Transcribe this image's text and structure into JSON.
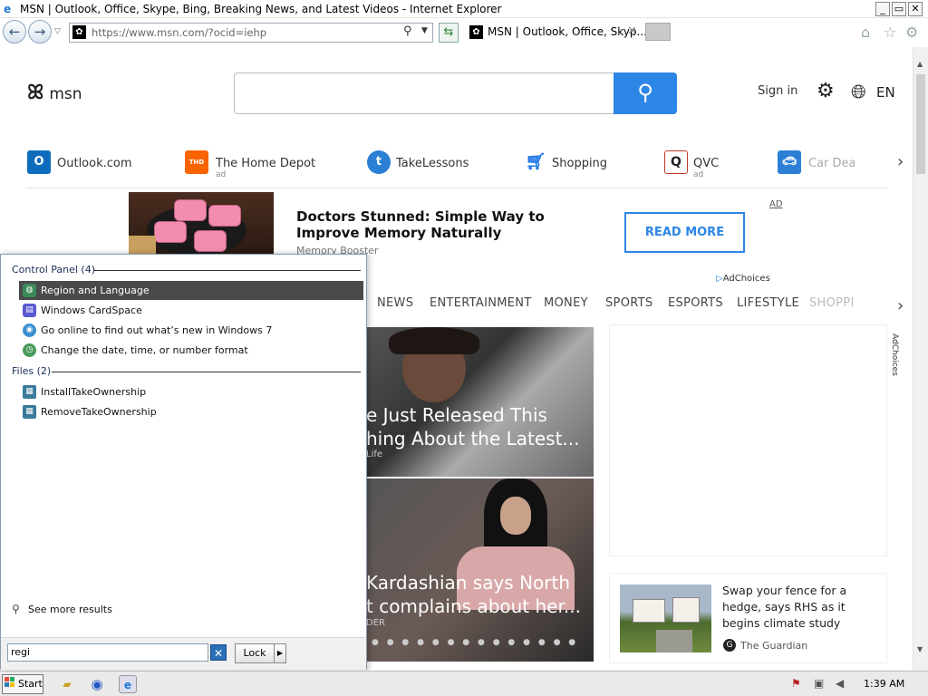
{
  "window": {
    "title": "MSN | Outlook, Office, Skype, Bing, Breaking News, and Latest Videos - Internet Explorer",
    "min": "_",
    "max": "▭",
    "close": "✕"
  },
  "browser": {
    "url": "https://www.msn.com/?ocid=iehp",
    "tab_title": "MSN | Outlook, Office, Skyp...",
    "tab_close": "✕"
  },
  "msn": {
    "logo_text": "msn",
    "search_placeholder": "",
    "sign_in": "Sign in",
    "language": "EN",
    "quicklinks": [
      {
        "label": "Outlook.com",
        "ad": "",
        "icon": "outlook-icon",
        "color": "#0f6cbd"
      },
      {
        "label": "The Home Depot",
        "ad": "ad",
        "icon": "home-depot-icon",
        "color": "#f96302"
      },
      {
        "label": "TakeLessons",
        "ad": "",
        "icon": "takelessons-icon",
        "color": "#2b7fd4"
      },
      {
        "label": "Shopping",
        "ad": "",
        "icon": "cart-icon",
        "color": "#1a73e8"
      },
      {
        "label": "QVC",
        "ad": "ad",
        "icon": "qvc-icon",
        "color": "#c0392b"
      },
      {
        "label": "Car Deal",
        "ad": "",
        "icon": "car-icon",
        "color": "#2b7fd4"
      }
    ],
    "ad": {
      "headline": "Doctors Stunned: Simple Way to Improve Memory Naturally",
      "source": "Memory Booster",
      "cta": "READ MORE",
      "label": "AD",
      "adchoices": "AdChoices"
    },
    "categories": [
      "NEWS",
      "ENTERTAINMENT",
      "MONEY",
      "SPORTS",
      "ESPORTS",
      "LIFESTYLE",
      "SHOPPI"
    ],
    "tiles": [
      {
        "headline_1": "e Just Released This",
        "headline_2": "hing About the Latest...",
        "source": "Life"
      },
      {
        "headline_1": "Kardashian says North",
        "headline_2": "t complains about her...",
        "source": "DER"
      }
    ],
    "carousel_dots": "● ● ● ● ● ● ● ● ● ● ● ● ● ●",
    "right_adchoices": "AdChoices",
    "news": {
      "headline": "Swap your fence for a hedge, says RHS as it begins climate study",
      "source": "The Guardian"
    }
  },
  "start_menu": {
    "section_control_panel": "Control Panel (4)",
    "control_panel_items": [
      {
        "label": "Region and Language",
        "icon": "region-language-icon",
        "color": "#3a8a5a"
      },
      {
        "label": "Windows CardSpace",
        "icon": "cardspace-icon",
        "color": "#5a5ad0"
      },
      {
        "label": "Go online to find out what’s new in Windows 7",
        "icon": "globe-icon",
        "color": "#3a8fd0"
      },
      {
        "label": "Change the date, time, or number format",
        "icon": "clock-globe-icon",
        "color": "#4a9a5a"
      }
    ],
    "section_files": "Files (2)",
    "file_items": [
      {
        "label": "InstallTakeOwnership",
        "icon": "registry-file-icon",
        "color": "#3a7a9a"
      },
      {
        "label": "RemoveTakeOwnership",
        "icon": "registry-file-icon",
        "color": "#3a7a9a"
      }
    ],
    "see_more": "See more results",
    "search_value": "regi",
    "lock_button": "Lock"
  },
  "taskbar": {
    "start": "Start",
    "clock": "1:39 AM"
  }
}
